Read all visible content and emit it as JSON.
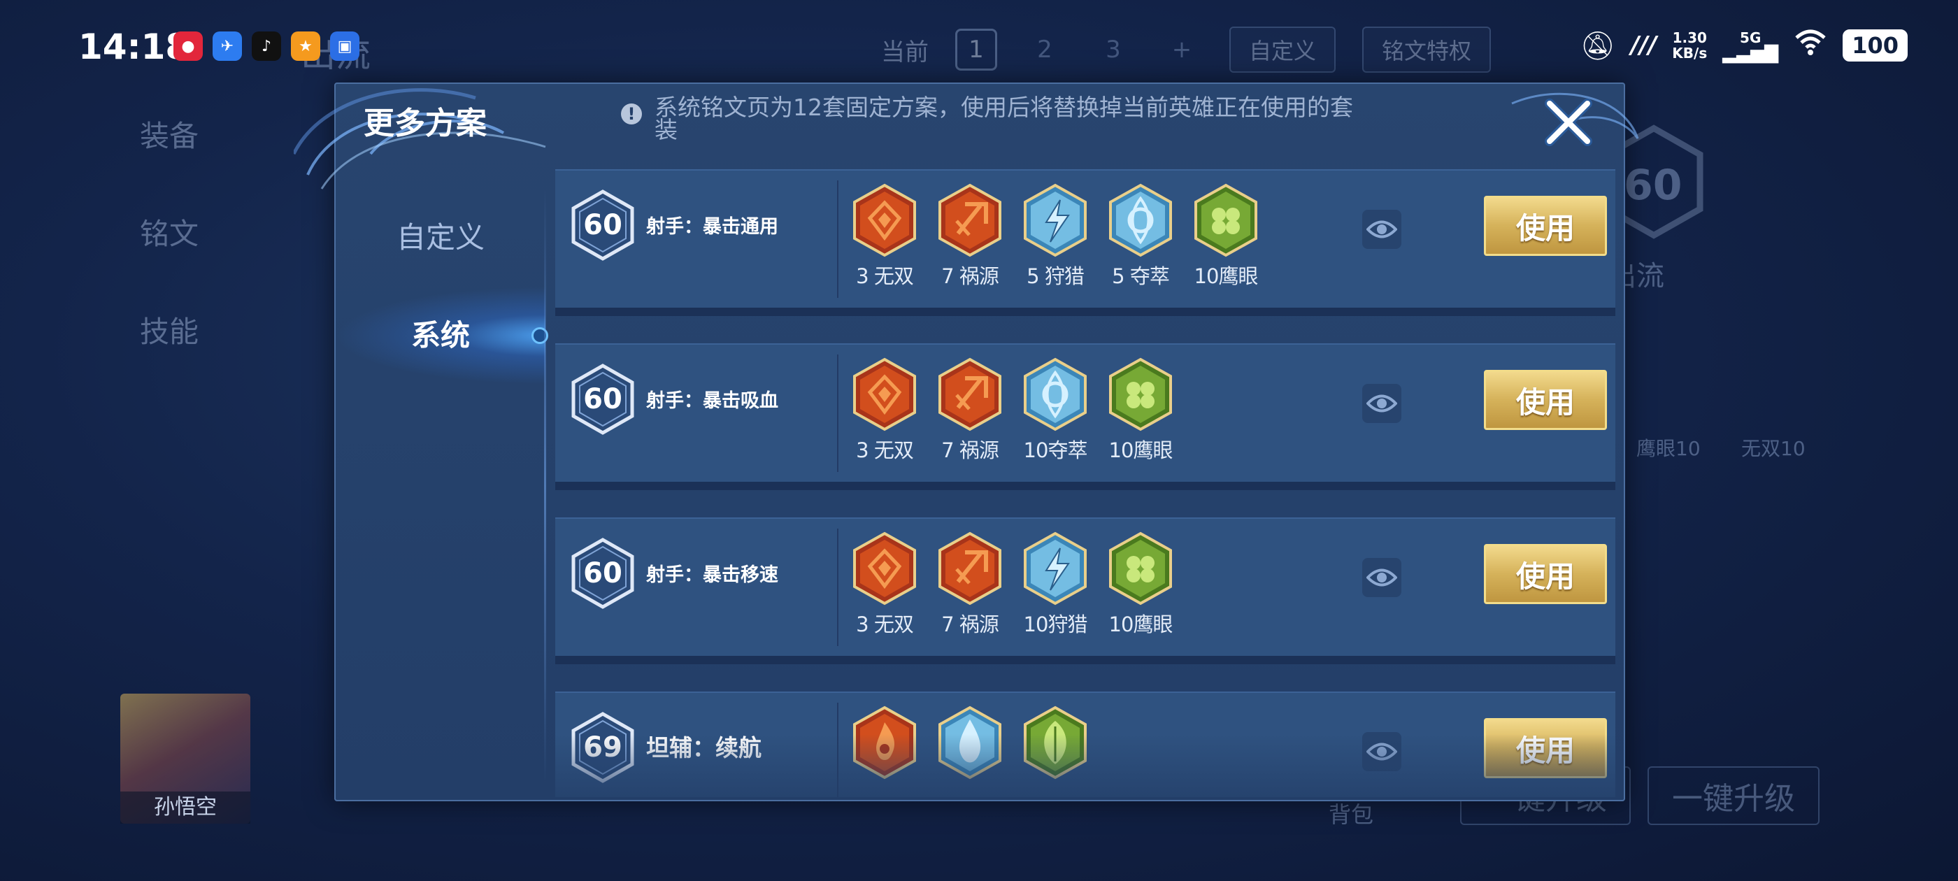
{
  "status_bar": {
    "time": "14:18",
    "network_speed": "1.30",
    "network_unit": "KB/s",
    "signal": "5G",
    "battery": "100",
    "apps": [
      "app-red-icon",
      "app-blue-icon",
      "tiktok-icon",
      "app-orange-icon",
      "app-chat-icon"
    ]
  },
  "background": {
    "tabs": {
      "current": "当前",
      "num1": "1",
      "num2": "2",
      "num3": "3",
      "plus": "+",
      "custom": "自定义",
      "privilege": "铭文特权"
    },
    "left_menu": [
      "装备",
      "铭文",
      "技能"
    ],
    "title_fragment": "出流",
    "right_title_fragment": "出流",
    "level_fragment": "60",
    "rune_labels": [
      "鹰眼10",
      "无双10"
    ],
    "hero_name": "孙悟空",
    "backpack": "背包",
    "upgrade_button": "一键升级",
    "left_button": "一键升级"
  },
  "modal": {
    "title": "更多方案",
    "info": "系统铭文页为12套固定方案，使用后将替换掉当前英雄正在使用的套装",
    "tabs": [
      "自定义",
      "系统"
    ],
    "active_tab": "系统",
    "use_label": "使用",
    "rows": [
      {
        "level": "60",
        "name": "射手：暴击通用",
        "runes": [
          {
            "label": "3 无双",
            "type": "red-flame"
          },
          {
            "label": "7 祸源",
            "type": "red-axe"
          },
          {
            "label": "5 狩猎",
            "type": "blue-bolt"
          },
          {
            "label": "5 夺萃",
            "type": "blue-knot"
          },
          {
            "label": "10鹰眼",
            "type": "green-clover"
          }
        ]
      },
      {
        "level": "60",
        "name": "射手：暴击吸血",
        "runes": [
          {
            "label": "3 无双",
            "type": "red-flame"
          },
          {
            "label": "7 祸源",
            "type": "red-axe"
          },
          {
            "label": "10夺萃",
            "type": "blue-knot"
          },
          {
            "label": "10鹰眼",
            "type": "green-clover"
          }
        ]
      },
      {
        "level": "60",
        "name": "射手：暴击移速",
        "runes": [
          {
            "label": "3 无双",
            "type": "red-flame"
          },
          {
            "label": "7 祸源",
            "type": "red-axe"
          },
          {
            "label": "10狩猎",
            "type": "blue-bolt"
          },
          {
            "label": "10鹰眼",
            "type": "green-clover"
          }
        ]
      },
      {
        "level": "69",
        "name": "坦辅：续航",
        "runes": [
          {
            "label": "",
            "type": "red-fire"
          },
          {
            "label": "",
            "type": "blue-drop"
          },
          {
            "label": "",
            "type": "green-leaf"
          }
        ]
      }
    ]
  },
  "colors": {
    "gold": "#d5b25a",
    "panel": "#2f5280",
    "red_rune": "#d9541f",
    "blue_rune": "#7fc7ea",
    "green_rune": "#7fb23a"
  }
}
